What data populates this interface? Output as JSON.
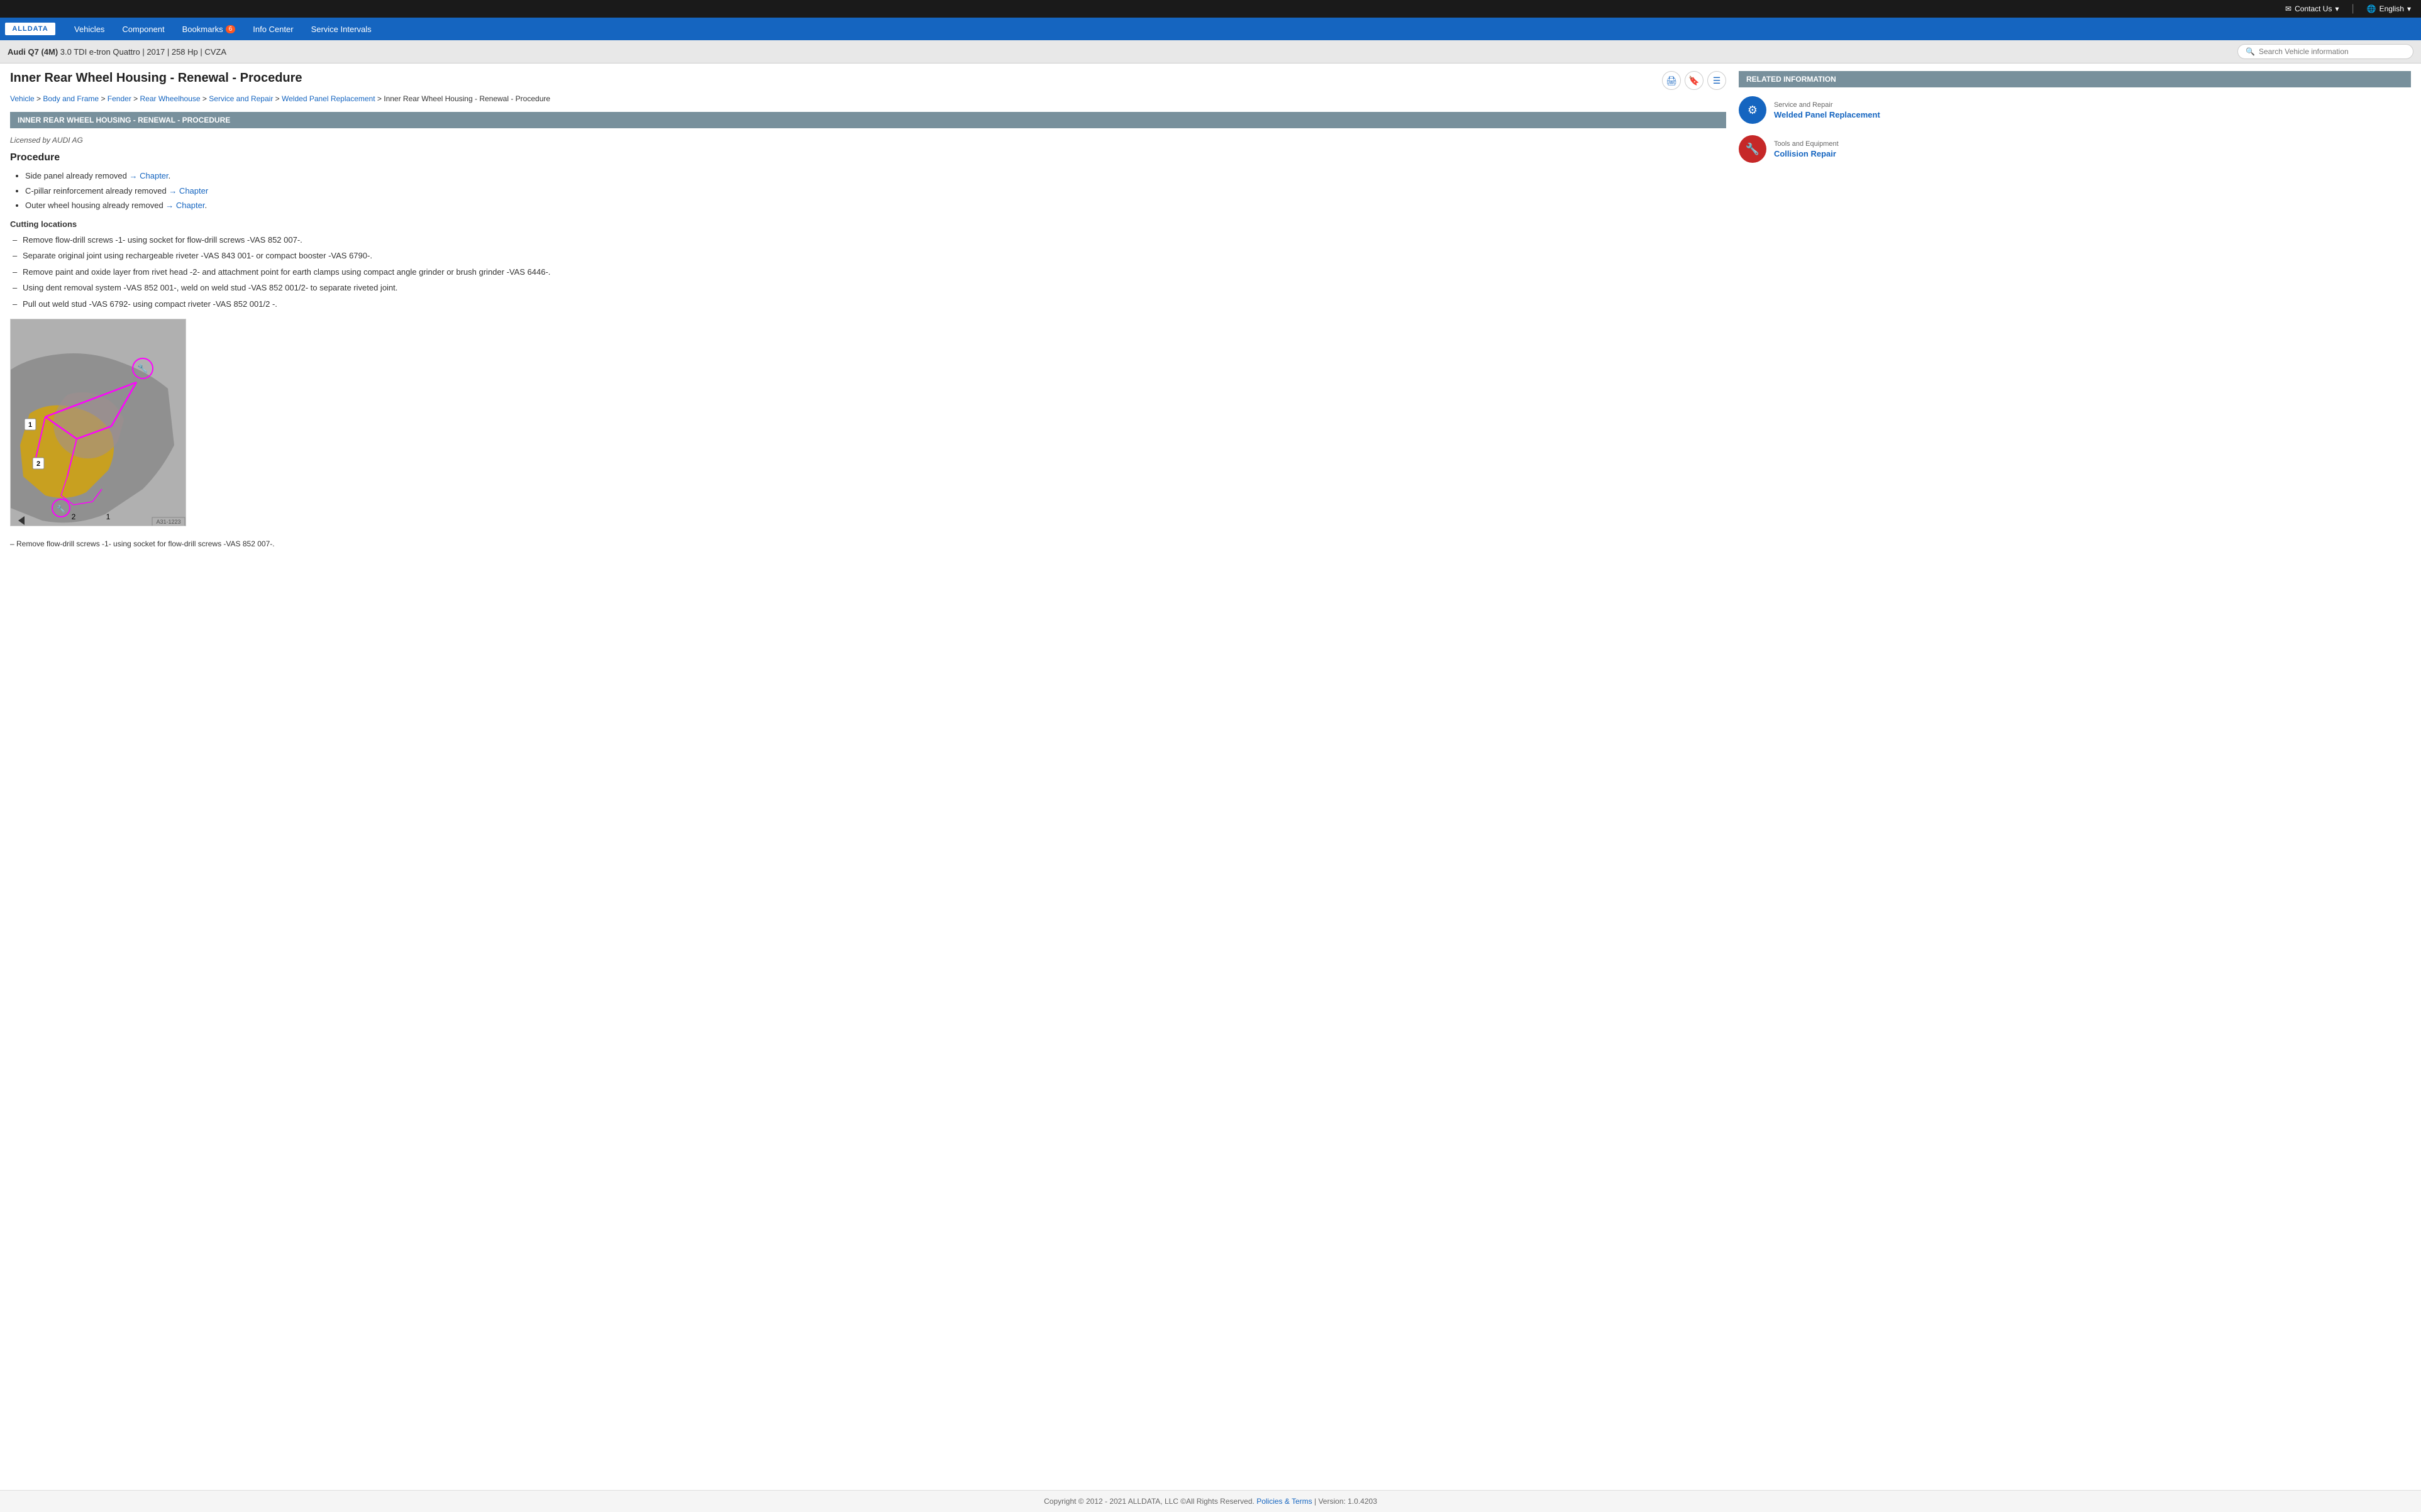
{
  "topbar": {
    "contact_label": "Contact Us",
    "language_label": "English"
  },
  "nav": {
    "logo": "ALLDATA",
    "items": [
      {
        "label": "Vehicles",
        "badge": null
      },
      {
        "label": "Component",
        "badge": null
      },
      {
        "label": "Bookmarks",
        "badge": "6"
      },
      {
        "label": "Info Center",
        "badge": null
      },
      {
        "label": "Service Intervals",
        "badge": null
      }
    ]
  },
  "vehicle": {
    "name": "Audi Q7 (4M)",
    "specs": "3.0 TDI e-tron Quattro | 2017 | 258 Hp | CVZA",
    "search_placeholder": "Search Vehicle information"
  },
  "page": {
    "title": "Inner Rear Wheel Housing - Renewal - Procedure",
    "section_header": "INNER REAR WHEEL HOUSING - RENEWAL - PROCEDURE",
    "licensed_by": "Licensed by AUDI AG",
    "procedure_title": "Procedure",
    "cutting_title": "Cutting locations",
    "breadcrumbs": [
      "Vehicle",
      "Body and Frame",
      "Fender",
      "Rear Wheelhouse",
      "Service and Repair",
      "Welded Panel Replacement",
      "Inner Rear Wheel Housing - Renewal - Procedure"
    ],
    "bullet_items": [
      {
        "text": "Side panel already removed ",
        "link": "→ Chapter",
        "link_href": "#"
      },
      {
        "text": "C-pillar reinforcement already removed ",
        "link": "→ Chapter",
        "link_href": "#"
      },
      {
        "text": "Outer wheel housing already removed ",
        "link": "→ Chapter",
        "link_href": "#"
      }
    ],
    "dash_items": [
      "Remove flow-drill screws -1- using socket for flow-drill screws -VAS 852 007-.",
      "Separate original joint using rechargeable riveter -VAS 843 001- or compact booster -VAS 6790-.",
      "Remove paint and oxide layer from rivet head -2- and attachment point for earth clamps using compact angle grinder or brush grinder -VAS 6446-.",
      "Using dent removal system -VAS 852 001-, weld on weld stud -VAS 852 001/2- to separate riveted joint.",
      "Pull out weld stud -VAS 6792- using compact riveter -VAS 852 001/2 -."
    ],
    "diagram_caption": "Remove flow-drill screws -1- using socket for flow-drill screws -VAS 852 007-.",
    "diagram_ref": "A31-1223"
  },
  "related": {
    "header": "RELATED INFORMATION",
    "items": [
      {
        "type": "blue",
        "category": "Service and Repair",
        "link": "Welded Panel Replacement"
      },
      {
        "type": "red",
        "category": "Tools and Equipment",
        "link": "Collision Repair"
      }
    ]
  },
  "footer": {
    "copyright": "Copyright © 2012 - 2021 ALLDATA, LLC ©All Rights Reserved.",
    "policies_label": "Policies & Terms",
    "version": "| Version: 1.0.4203"
  }
}
